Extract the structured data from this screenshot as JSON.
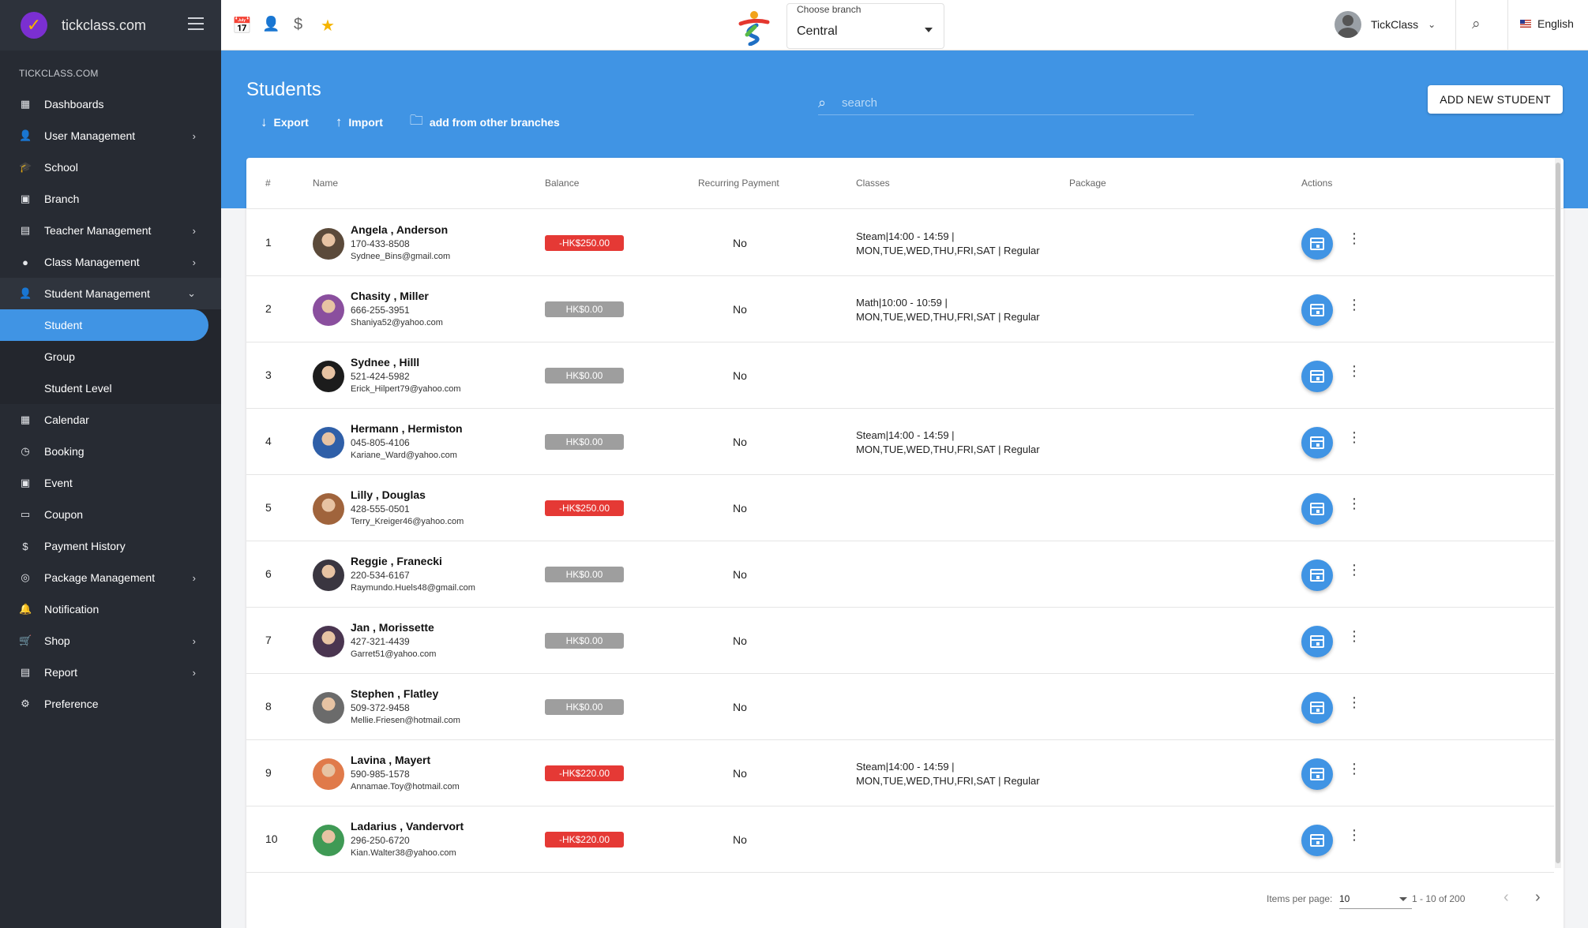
{
  "brand": {
    "name": "tickclass.com"
  },
  "sidebar": {
    "section": "TICKCLASS.COM",
    "items": [
      {
        "label": "Dashboards",
        "icon": "dashboard-icon",
        "glyph": "▦",
        "chevron": ""
      },
      {
        "label": "User Management",
        "icon": "user-icon",
        "glyph": "👤",
        "chevron": "›"
      },
      {
        "label": "School",
        "icon": "school-icon",
        "glyph": "🎓",
        "chevron": ""
      },
      {
        "label": "Branch",
        "icon": "branch-icon",
        "glyph": "▣",
        "chevron": ""
      },
      {
        "label": "Teacher Management",
        "icon": "teacher-icon",
        "glyph": "▤",
        "chevron": "›"
      },
      {
        "label": "Class Management",
        "icon": "class-icon",
        "glyph": "●",
        "chevron": "›"
      },
      {
        "label": "Student Management",
        "icon": "student-icon",
        "glyph": "👤",
        "chevron": "⌄"
      }
    ],
    "sub_items": [
      {
        "label": "Student"
      },
      {
        "label": "Group"
      },
      {
        "label": "Student Level"
      }
    ],
    "items_after": [
      {
        "label": "Calendar",
        "icon": "calendar-icon",
        "glyph": "▦",
        "chevron": ""
      },
      {
        "label": "Booking",
        "icon": "booking-icon",
        "glyph": "◷",
        "chevron": ""
      },
      {
        "label": "Event",
        "icon": "event-icon",
        "glyph": "▣",
        "chevron": ""
      },
      {
        "label": "Coupon",
        "icon": "coupon-icon",
        "glyph": "▭",
        "chevron": ""
      },
      {
        "label": "Payment History",
        "icon": "dollar-icon",
        "glyph": "$",
        "chevron": ""
      },
      {
        "label": "Package Management",
        "icon": "package-icon",
        "glyph": "◎",
        "chevron": "›"
      },
      {
        "label": "Notification",
        "icon": "bell-icon",
        "glyph": "🔔",
        "chevron": ""
      },
      {
        "label": "Shop",
        "icon": "cart-icon",
        "glyph": "🛒",
        "chevron": "›"
      },
      {
        "label": "Report",
        "icon": "report-icon",
        "glyph": "▤",
        "chevron": "›"
      },
      {
        "label": "Preference",
        "icon": "gear-icon",
        "glyph": "⚙",
        "chevron": ""
      }
    ]
  },
  "topbar": {
    "branch_label": "Choose branch",
    "branch_value": "Central",
    "user_name": "TickClass",
    "language": "English"
  },
  "page": {
    "title": "Students",
    "export": "Export",
    "import": "Import",
    "add_from_branches": "add from other branches",
    "search_placeholder": "search",
    "add_button": "ADD NEW STUDENT"
  },
  "table": {
    "headers": {
      "num": "#",
      "name": "Name",
      "balance": "Balance",
      "recurring": "Recurring Payment",
      "classes": "Classes",
      "package": "Package",
      "actions": "Actions"
    },
    "rows": [
      {
        "num": "1",
        "name": "Angela , Anderson",
        "phone": "170-433-8508",
        "email": "Sydnee_Bins@gmail.com",
        "balance": "-HK$250.00",
        "balance_state": "neg",
        "recurring": "No",
        "class_line1": "Steam|14:00 - 14:59 |",
        "class_line2": "MON,TUE,WED,THU,FRI,SAT | Regular",
        "avatar_color": "#5b4a3a"
      },
      {
        "num": "2",
        "name": "Chasity , Miller",
        "phone": "666-255-3951",
        "email": "Shaniya52@yahoo.com",
        "balance": "HK$0.00",
        "balance_state": "zero",
        "recurring": "No",
        "class_line1": "Math|10:00 - 10:59 |",
        "class_line2": "MON,TUE,WED,THU,FRI,SAT | Regular",
        "avatar_color": "#8a4f9e"
      },
      {
        "num": "3",
        "name": "Sydnee , Hilll",
        "phone": "521-424-5982",
        "email": "Erick_Hilpert79@yahoo.com",
        "balance": "HK$0.00",
        "balance_state": "zero",
        "recurring": "No",
        "class_line1": "",
        "class_line2": "",
        "avatar_color": "#1c1c1c"
      },
      {
        "num": "4",
        "name": "Hermann , Hermiston",
        "phone": "045-805-4106",
        "email": "Kariane_Ward@yahoo.com",
        "balance": "HK$0.00",
        "balance_state": "zero",
        "recurring": "No",
        "class_line1": "Steam|14:00 - 14:59 |",
        "class_line2": "MON,TUE,WED,THU,FRI,SAT | Regular",
        "avatar_color": "#2f5fa8"
      },
      {
        "num": "5",
        "name": "Lilly , Douglas",
        "phone": "428-555-0501",
        "email": "Terry_Kreiger46@yahoo.com",
        "balance": "-HK$250.00",
        "balance_state": "neg",
        "recurring": "No",
        "class_line1": "",
        "class_line2": "",
        "avatar_color": "#a0643c"
      },
      {
        "num": "6",
        "name": "Reggie , Franecki",
        "phone": "220-534-6167",
        "email": "Raymundo.Huels48@gmail.com",
        "balance": "HK$0.00",
        "balance_state": "zero",
        "recurring": "No",
        "class_line1": "",
        "class_line2": "",
        "avatar_color": "#3a3640"
      },
      {
        "num": "7",
        "name": "Jan , Morissette",
        "phone": "427-321-4439",
        "email": "Garret51@yahoo.com",
        "balance": "HK$0.00",
        "balance_state": "zero",
        "recurring": "No",
        "class_line1": "",
        "class_line2": "",
        "avatar_color": "#4a3550"
      },
      {
        "num": "8",
        "name": "Stephen , Flatley",
        "phone": "509-372-9458",
        "email": "Mellie.Friesen@hotmail.com",
        "balance": "HK$0.00",
        "balance_state": "zero",
        "recurring": "No",
        "class_line1": "",
        "class_line2": "",
        "avatar_color": "#6b6b6b"
      },
      {
        "num": "9",
        "name": "Lavina , Mayert",
        "phone": "590-985-1578",
        "email": "Annamae.Toy@hotmail.com",
        "balance": "-HK$220.00",
        "balance_state": "neg",
        "recurring": "No",
        "class_line1": "Steam|14:00 - 14:59 |",
        "class_line2": "MON,TUE,WED,THU,FRI,SAT | Regular",
        "avatar_color": "#e07a4a"
      },
      {
        "num": "10",
        "name": "Ladarius , Vandervort",
        "phone": "296-250-6720",
        "email": "Kian.Walter38@yahoo.com",
        "balance": "-HK$220.00",
        "balance_state": "neg",
        "recurring": "No",
        "class_line1": "",
        "class_line2": "",
        "avatar_color": "#3f9a55"
      }
    ]
  },
  "pagination": {
    "items_per_page_label": "Items per page:",
    "items_per_page": "10",
    "range": "1 - 10 of 200"
  },
  "colors": {
    "primary": "#4094e4",
    "sidebar": "#272b33",
    "negative": "#e53935",
    "neutral": "#9e9e9e"
  }
}
